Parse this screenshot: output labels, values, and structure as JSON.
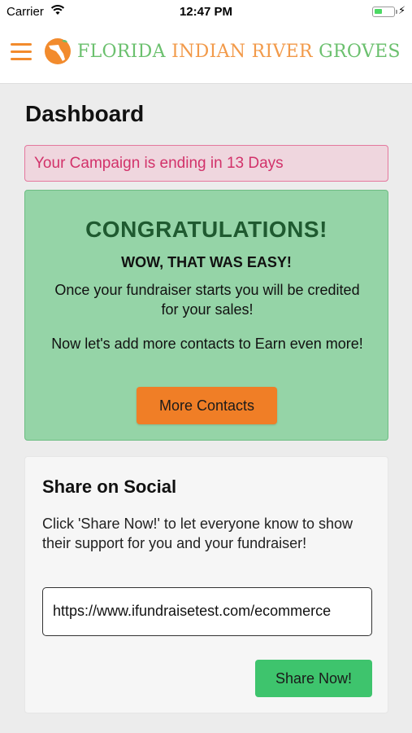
{
  "status_bar": {
    "carrier": "Carrier",
    "time": "12:47 PM",
    "battery_level_percent": 40
  },
  "header": {
    "brand_word1": "FLORIDA",
    "brand_word2": "INDIAN RIVER",
    "brand_word3": "GROVES",
    "menu_icon": "hamburger-icon",
    "logo_icon": "florida-orange-logo-icon",
    "colors": {
      "accent_orange": "#f28b2d",
      "brand_green": "#6bc06e"
    }
  },
  "page": {
    "title": "Dashboard"
  },
  "alert": {
    "text": "Your Campaign is ending in 13 Days",
    "color": "#d2326a"
  },
  "congrats": {
    "heading": "CONGRATULATIONS!",
    "subheading": "WOW, THAT WAS EASY!",
    "paragraph1": "Once your fundraiser starts you will be credited for your sales!",
    "paragraph2": "Now let's add more contacts to Earn even more!",
    "button_label": "More Contacts"
  },
  "social": {
    "title": "Share on Social",
    "description": "Click 'Share Now!' to let everyone know to show their support for you and your fundraiser!",
    "url_value": "https://www.ifundraisetest.com/ecommerce",
    "share_button_label": "Share Now!"
  }
}
